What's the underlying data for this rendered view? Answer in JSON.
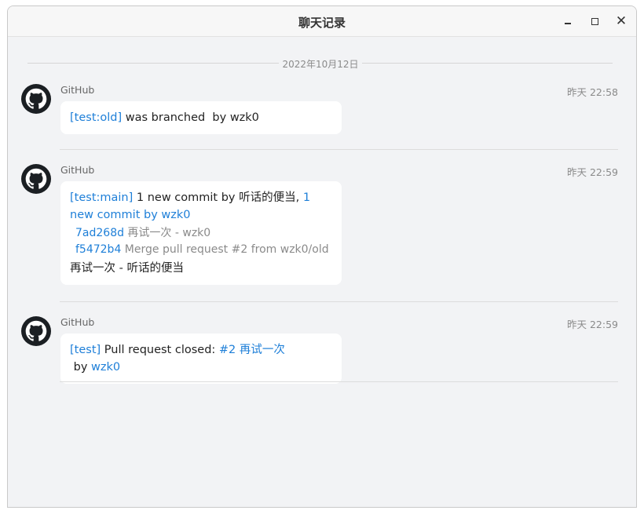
{
  "window": {
    "title": "聊天记录"
  },
  "date_separator": "2022年10月12日",
  "messages": [
    {
      "sender": "GitHub",
      "time": "昨天 22:58",
      "line1": {
        "ref": "[test:old]",
        "text": " was branched  by wzk0"
      }
    },
    {
      "sender": "GitHub",
      "time": "昨天 22:59",
      "line1": {
        "ref": "[test:main]",
        "text": " 1 new commit by 听话的便当, ",
        "link": "1 new commit by wzk0"
      },
      "commits": [
        {
          "hash": "7ad268d",
          "message": " 再试一次 - wzk0"
        },
        {
          "hash": "f5472b4",
          "message": " Merge pull request #2 from wzk0/old"
        }
      ],
      "footer": "再试一次 - 听话的便当"
    },
    {
      "sender": "GitHub",
      "time": "昨天 22:59",
      "line1": {
        "ref": "[test]",
        "text": " Pull request closed: ",
        "link": "#2 再试一次",
        "text2": " by ",
        "link2": "wzk0"
      }
    }
  ]
}
